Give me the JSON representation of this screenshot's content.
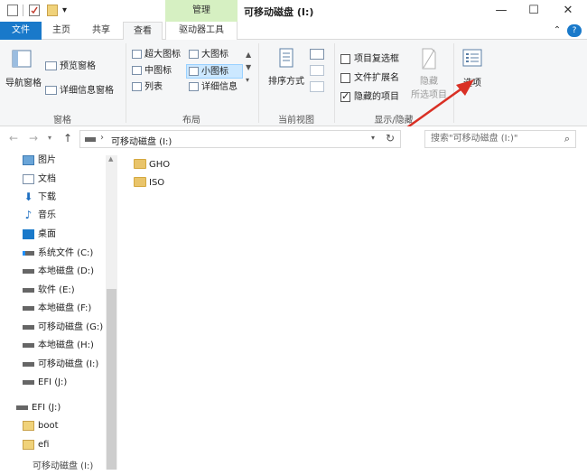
{
  "window": {
    "title": "可移动磁盘 (I:)",
    "context_tab": "管理",
    "minimize": "—",
    "maximize": "☐",
    "close": "✕"
  },
  "tabs": {
    "file": "文件",
    "home": "主页",
    "share": "共享",
    "view": "查看",
    "drive_tools": "驱动器工具",
    "collapse": "⌃",
    "help": "?"
  },
  "ribbon": {
    "panes": {
      "nav_pane": "导航窗格",
      "preview": "预览窗格",
      "details": "详细信息窗格",
      "group": "窗格"
    },
    "layout": {
      "xl_icons": "超大图标",
      "large_icons": "大图标",
      "medium_icons": "中图标",
      "small_icons": "小图标",
      "list": "列表",
      "details": "详细信息",
      "group": "布局"
    },
    "current_view": {
      "sort_by": "排序方式",
      "group": "当前视图"
    },
    "show_hide": {
      "item_checkboxes": "项目复选框",
      "file_extensions": "文件扩展名",
      "hidden_items": "隐藏的项目",
      "hide": "隐藏",
      "selected_items": "所选项目",
      "group": "显示/隐藏",
      "item_checkboxes_checked": false,
      "file_extensions_checked": false,
      "hidden_items_checked": true
    },
    "options": "选项"
  },
  "address": {
    "path": "可移动磁盘 (I:)",
    "search_placeholder": "搜索\"可移动磁盘 (I:)\""
  },
  "nav": {
    "items": [
      {
        "label": "图片",
        "icon": "pictures-icon"
      },
      {
        "label": "文档",
        "icon": "documents-icon"
      },
      {
        "label": "下载",
        "icon": "download-icon"
      },
      {
        "label": "音乐",
        "icon": "music-icon"
      },
      {
        "label": "桌面",
        "icon": "desktop-icon"
      },
      {
        "label": "系统文件 (C:)",
        "icon": "drive-c-icon"
      },
      {
        "label": "本地磁盘 (D:)",
        "icon": "drive-icon"
      },
      {
        "label": "软件 (E:)",
        "icon": "drive-icon"
      },
      {
        "label": "本地磁盘 (F:)",
        "icon": "drive-icon"
      },
      {
        "label": "可移动磁盘 (G:)",
        "icon": "usb-drive-icon"
      },
      {
        "label": "本地磁盘 (H:)",
        "icon": "drive-icon"
      },
      {
        "label": "可移动磁盘 (I:)",
        "icon": "usb-drive-icon"
      },
      {
        "label": "EFI (J:)",
        "icon": "drive-icon"
      }
    ],
    "efi_root": "EFI (J:)",
    "efi_children": [
      "boot",
      "efi"
    ],
    "bottom_item": "可移动磁盘 (I:)"
  },
  "files": [
    "GHO",
    "ISO"
  ],
  "colors": {
    "accent": "#1979ca",
    "manage_tab_bg": "#d6f0c2",
    "arrow": "#d93025",
    "folder": "#e9c46a"
  }
}
